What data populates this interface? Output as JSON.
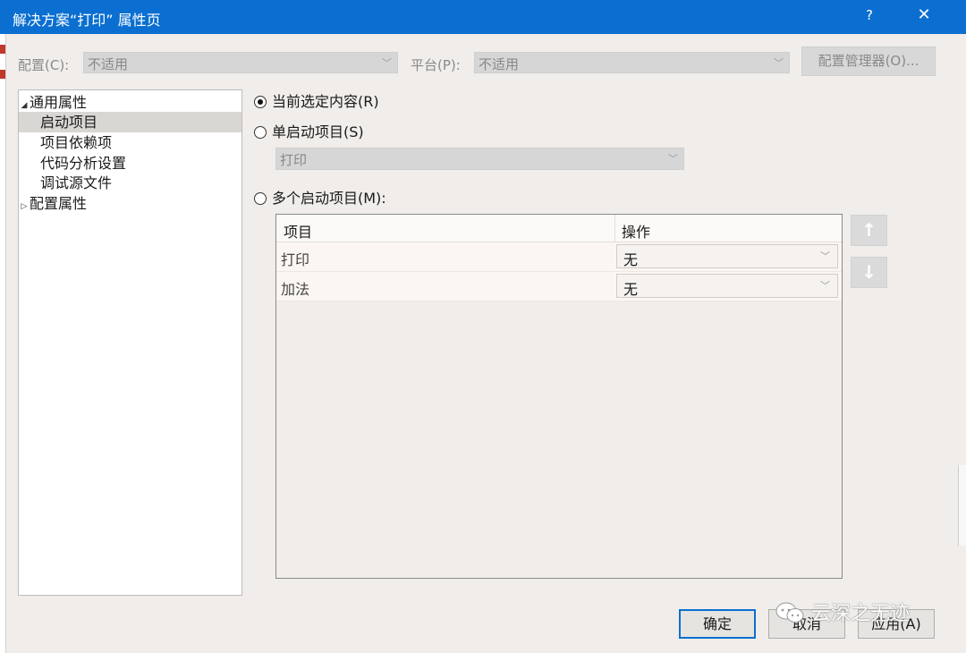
{
  "window": {
    "title": "解决方案“打印” 属性页",
    "help": "?",
    "close": "✕"
  },
  "toolbar": {
    "config_label": "配置(C):",
    "config_value": "不适用",
    "platform_label": "平台(P):",
    "platform_value": "不适用",
    "config_manager": "配置管理器(O)..."
  },
  "tree": {
    "items": [
      {
        "label": "通用属性",
        "expander": "◢"
      },
      {
        "label": "启动项目"
      },
      {
        "label": "项目依赖项"
      },
      {
        "label": "代码分析设置"
      },
      {
        "label": "调试源文件"
      },
      {
        "label": "配置属性",
        "expander": "▷"
      }
    ]
  },
  "startup": {
    "option_current": "当前选定内容(R)",
    "option_single": "单启动项目(S)",
    "single_value": "打印",
    "option_multiple": "多个启动项目(M):",
    "selected": "current"
  },
  "grid": {
    "headers": [
      "项目",
      "操作"
    ],
    "rows": [
      {
        "project": "打印",
        "action": "无"
      },
      {
        "project": "加法",
        "action": "无"
      }
    ]
  },
  "buttons": {
    "ok": "确定",
    "cancel": "取消",
    "apply": "应用(A)"
  },
  "watermark": "云深之无迹",
  "colors": {
    "accent": "#0a6fd0",
    "background": "#f0edea",
    "disabled": "#d6d6d6"
  }
}
